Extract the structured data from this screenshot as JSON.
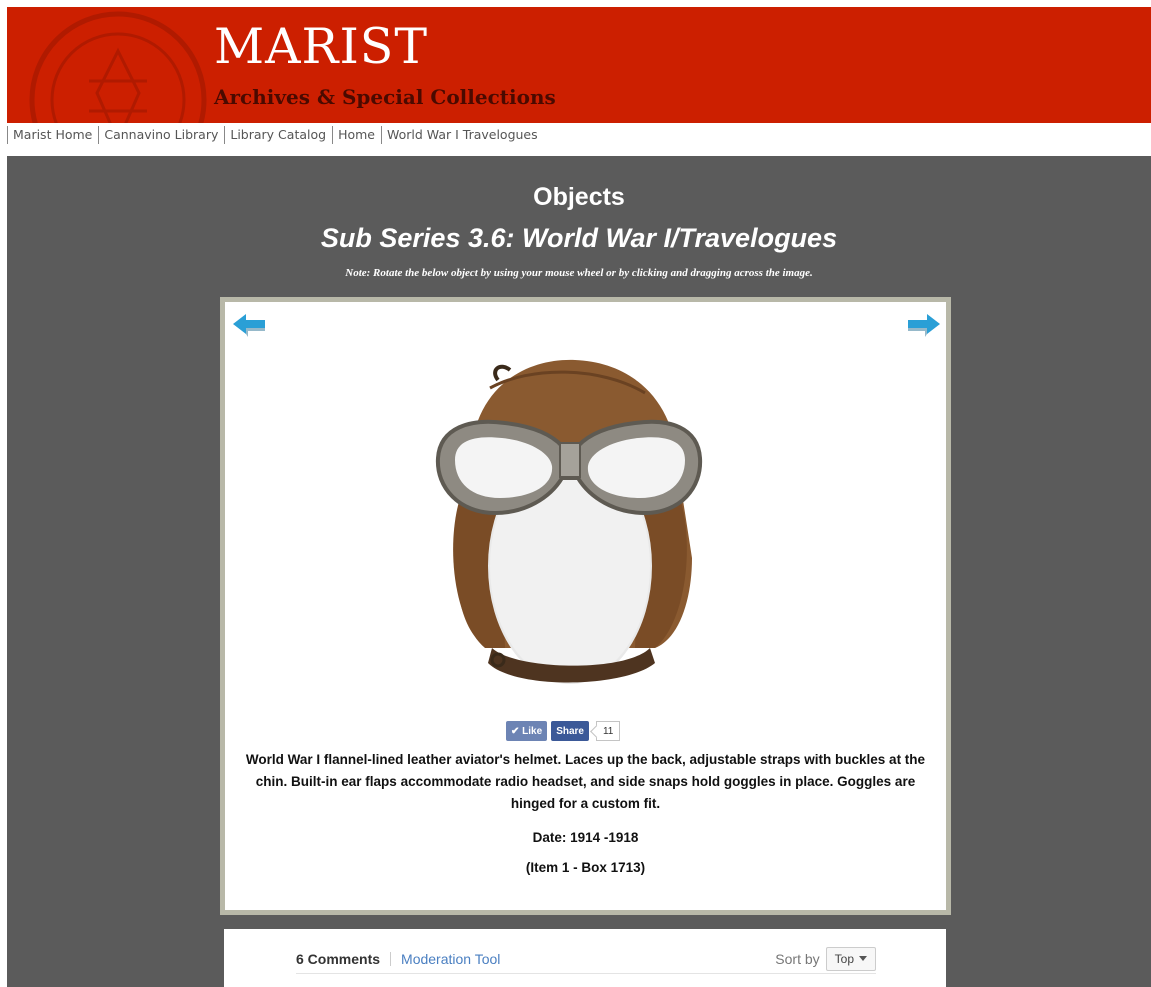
{
  "header": {
    "title": "MARIST",
    "subtitle": "Archives & Special Collections"
  },
  "nav": {
    "items": [
      {
        "label": "Marist Home"
      },
      {
        "label": "Cannavino Library"
      },
      {
        "label": "Library Catalog"
      },
      {
        "label": "Home"
      },
      {
        "label": "World War I Travelogues"
      }
    ]
  },
  "main": {
    "title": "Objects",
    "subtitle": "Sub Series 3.6: World War I/Travelogues",
    "note": "Note: Rotate the below object by using your mouse wheel or by clicking and dragging across the image."
  },
  "viewer": {
    "prev_icon": "left-arrow-icon",
    "next_icon": "right-arrow-icon",
    "image_subject": "leather aviator helmet with goggles"
  },
  "social": {
    "like_label": "Like",
    "share_label": "Share",
    "share_count": "11"
  },
  "item": {
    "description": "World War I flannel-lined leather aviator's helmet. Laces up the back, adjustable straps with buckles at the chin. Built-in ear flaps accommodate radio headset, and side snaps hold goggles in place. Goggles are hinged for a custom fit.",
    "date": "Date: 1914 -1918",
    "reference": "(Item 1 - Box 1713)"
  },
  "comments": {
    "count_label": "6 Comments",
    "moderation_label": "Moderation Tool",
    "sort_label": "Sort by",
    "sort_value": "Top"
  },
  "colors": {
    "header_red": "#cc1f00",
    "main_gray": "#5b5b5b",
    "arrow_blue": "#2a9fd6",
    "like_blue": "#6d84b4",
    "share_blue": "#3b5998"
  }
}
